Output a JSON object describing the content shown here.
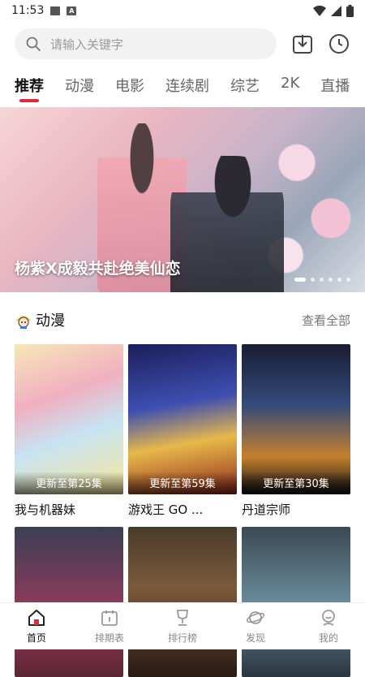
{
  "status_bar": {
    "time": "11:53"
  },
  "search": {
    "placeholder": "请输入关键字"
  },
  "tabs": [
    {
      "label": "推荐",
      "active": true
    },
    {
      "label": "动漫"
    },
    {
      "label": "电影"
    },
    {
      "label": "连续剧"
    },
    {
      "label": "综艺"
    },
    {
      "label": "2K"
    },
    {
      "label": "直播"
    }
  ],
  "banner": {
    "caption": "杨紫X成毅共赴绝美仙恋",
    "slide_count": 6,
    "active_slide": 1
  },
  "section": {
    "title": "动漫",
    "more_label": "查看全部"
  },
  "cards": [
    {
      "badge": "更新至第25集",
      "name": "我与机器妹"
    },
    {
      "badge": "更新至第59集",
      "name": "游戏王 GO ..."
    },
    {
      "badge": "更新至第30集",
      "name": "丹道宗师"
    },
    {
      "badge": "",
      "name": ""
    },
    {
      "badge": "",
      "name": ""
    },
    {
      "badge": "",
      "name": ""
    }
  ],
  "bottom_nav": [
    {
      "label": "首页",
      "icon": "home-icon",
      "active": true
    },
    {
      "label": "排期表",
      "icon": "calendar-icon"
    },
    {
      "label": "排行榜",
      "icon": "trophy-icon"
    },
    {
      "label": "发现",
      "icon": "planet-icon"
    },
    {
      "label": "我的",
      "icon": "profile-icon"
    }
  ],
  "colors": {
    "accent": "#e02b3f"
  }
}
